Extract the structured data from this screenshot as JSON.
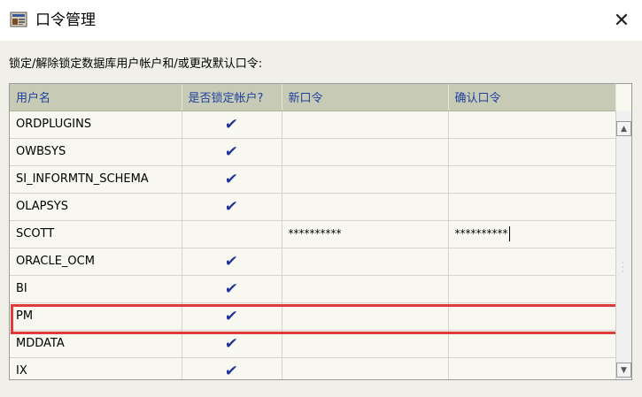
{
  "window": {
    "title": "口令管理",
    "close_label": "✕"
  },
  "instructions": "锁定/解除锁定数据库用户帐户和/或更改默认口令:",
  "grid": {
    "columns": [
      "用户名",
      "是否锁定帐户?",
      "新口令",
      "确认口令"
    ],
    "rows": [
      {
        "username": "ORDPLUGINS",
        "locked": true,
        "new_password": "",
        "confirm_password": ""
      },
      {
        "username": "OWBSYS",
        "locked": true,
        "new_password": "",
        "confirm_password": ""
      },
      {
        "username": "SI_INFORMTN_SCHEMA",
        "locked": true,
        "new_password": "",
        "confirm_password": ""
      },
      {
        "username": "OLAPSYS",
        "locked": true,
        "new_password": "",
        "confirm_password": ""
      },
      {
        "username": "SCOTT",
        "locked": false,
        "new_password": "**********",
        "confirm_password": "**********"
      },
      {
        "username": "ORACLE_OCM",
        "locked": true,
        "new_password": "",
        "confirm_password": ""
      },
      {
        "username": "BI",
        "locked": true,
        "new_password": "",
        "confirm_password": ""
      },
      {
        "username": "PM",
        "locked": true,
        "new_password": "",
        "confirm_password": ""
      },
      {
        "username": "MDDATA",
        "locked": true,
        "new_password": "",
        "confirm_password": ""
      },
      {
        "username": "IX",
        "locked": true,
        "new_password": "",
        "confirm_password": ""
      }
    ],
    "check_glyph": "✔",
    "highlighted_row": "SCOTT"
  },
  "colors": {
    "header_bg": "#c7cab4",
    "header_text": "#1f3f9f",
    "check": "#1c2f9a",
    "highlight": "#e03a3a"
  }
}
